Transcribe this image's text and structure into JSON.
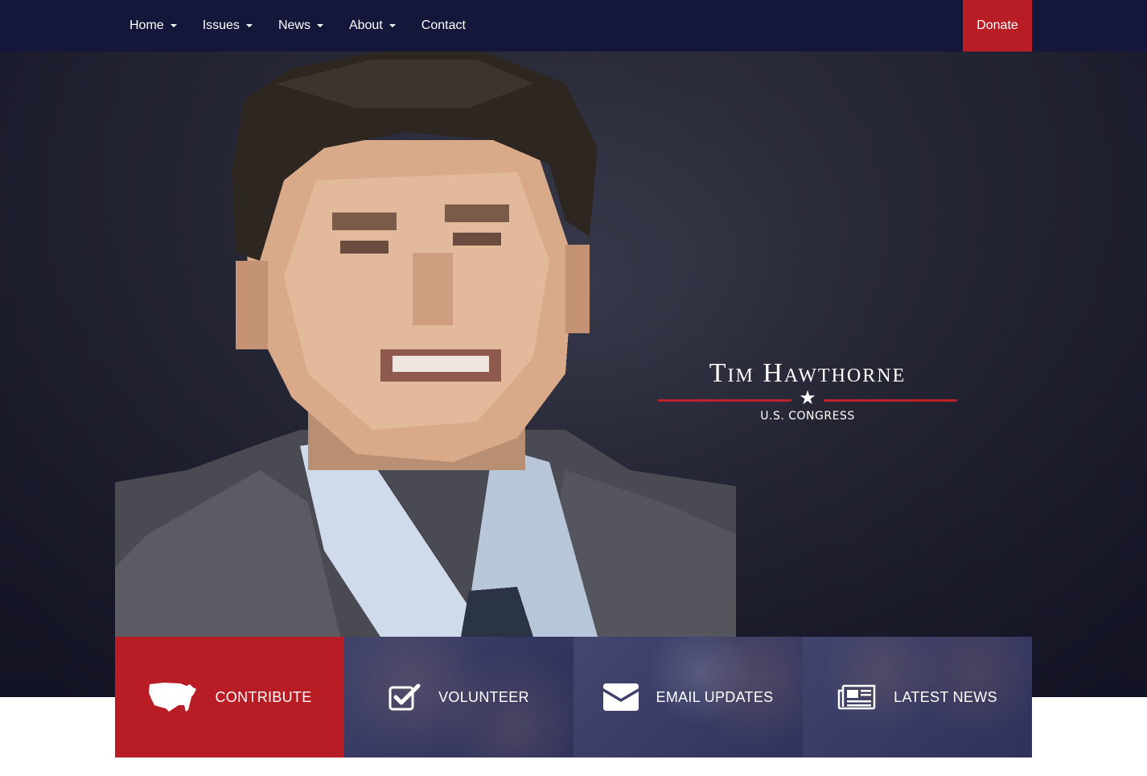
{
  "nav": {
    "items": [
      {
        "label": "Home",
        "dropdown": true
      },
      {
        "label": "Issues",
        "dropdown": true
      },
      {
        "label": "News",
        "dropdown": true
      },
      {
        "label": "About",
        "dropdown": true
      },
      {
        "label": "Contact",
        "dropdown": false
      }
    ],
    "donate_label": "Donate"
  },
  "hero": {
    "name": "Tim Hawthorne",
    "office": "U.S. CONGRESS",
    "star": "★"
  },
  "tiles": [
    {
      "label": "CONTRIBUTE",
      "icon": "usa-map-icon"
    },
    {
      "label": "VOLUNTEER",
      "icon": "checkbox-icon"
    },
    {
      "label": "EMAIL UPDATES",
      "icon": "envelope-icon"
    },
    {
      "label": "LATEST NEWS",
      "icon": "newspaper-icon"
    }
  ],
  "colors": {
    "navbar": "#14163a",
    "accent_red": "#b81c25",
    "hero_dark": "#17182a"
  }
}
